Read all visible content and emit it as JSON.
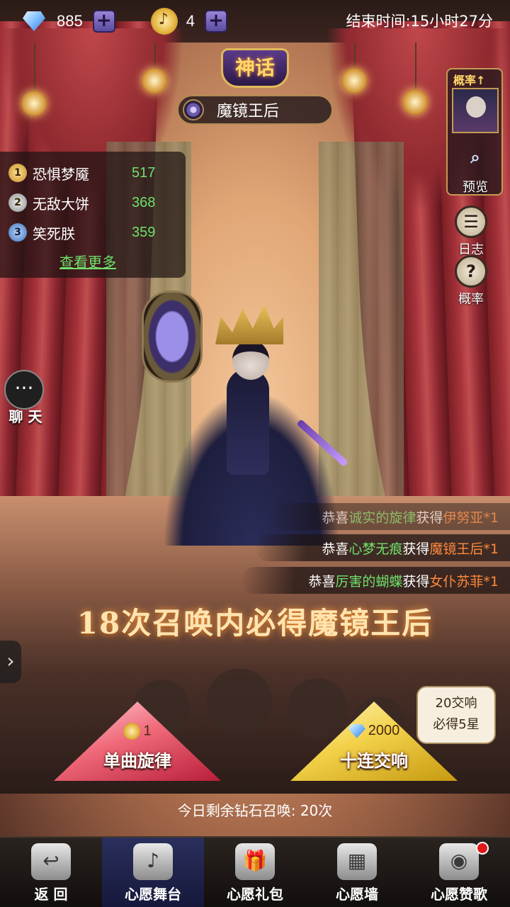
{
  "top_bar": {
    "gems": "885",
    "notes": "4",
    "end_time": "结束时间:15小时27分"
  },
  "banner": {
    "rarity": "神话",
    "hero_name": "魔镜王后"
  },
  "ranking": {
    "rows": [
      {
        "rank": "1",
        "name": "恐惧梦魇",
        "score": "517"
      },
      {
        "rank": "2",
        "name": "无敌大饼",
        "score": "368"
      },
      {
        "rank": "3",
        "name": "笑死朕",
        "score": "359"
      }
    ],
    "more": "查看更多"
  },
  "side": {
    "rate_up": "概率↑",
    "preview": "预览",
    "log": "日志",
    "probability": "概率",
    "chat": "聊 天"
  },
  "announcements": [
    {
      "pre": "恭喜",
      "user": "诚实的旋律",
      "mid": "获得",
      "item": "伊努亚*1"
    },
    {
      "pre": "恭喜",
      "user": "心梦无痕",
      "mid": "获得",
      "item": "魔镜王后*1"
    },
    {
      "pre": "恭喜",
      "user": "厉害的蝴蝶",
      "mid": "获得",
      "item": "女仆苏菲*1"
    }
  ],
  "guarantee": "18次召唤内必得魔镜王后",
  "summon": {
    "single_cost": "1",
    "single_label": "单曲旋律",
    "ten_cost": "2000",
    "ten_label": "十连交响",
    "badge_line1": "20交响",
    "badge_line2": "必得5星"
  },
  "remaining": "今日剩余钻石召唤: 20次",
  "nav": [
    {
      "label": "返 回"
    },
    {
      "label": "心愿舞台"
    },
    {
      "label": "心愿礼包"
    },
    {
      "label": "心愿墙"
    },
    {
      "label": "心愿赞歌"
    }
  ],
  "colors": {
    "highlight_green": "#6fe06a",
    "highlight_orange": "#ff8a3a",
    "gold": "#ffd86a"
  }
}
